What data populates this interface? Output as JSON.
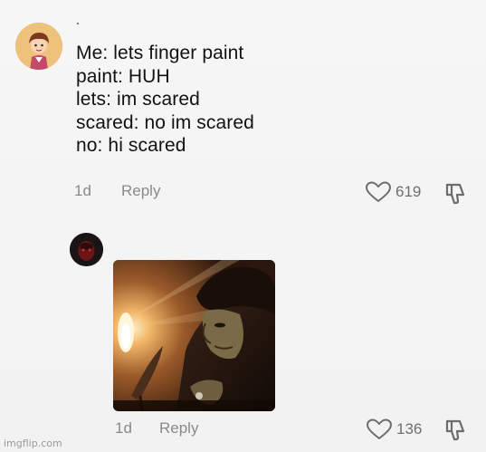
{
  "comments": [
    {
      "lines": [
        "Me: lets finger paint",
        "paint: HUH",
        "lets: im scared",
        "scared: no im scared",
        "no: hi scared"
      ],
      "time": "1d",
      "reply_label": "Reply",
      "likes": "619"
    },
    {
      "time": "1d",
      "reply_label": "Reply",
      "likes": "136"
    }
  ],
  "watermark": "imgflip.com",
  "icons": {
    "like": "heart-icon",
    "dislike": "thumbs-down-icon"
  },
  "colors": {
    "text": "#121212",
    "meta": "#8a8a8a",
    "background": "#f4f4f4"
  }
}
